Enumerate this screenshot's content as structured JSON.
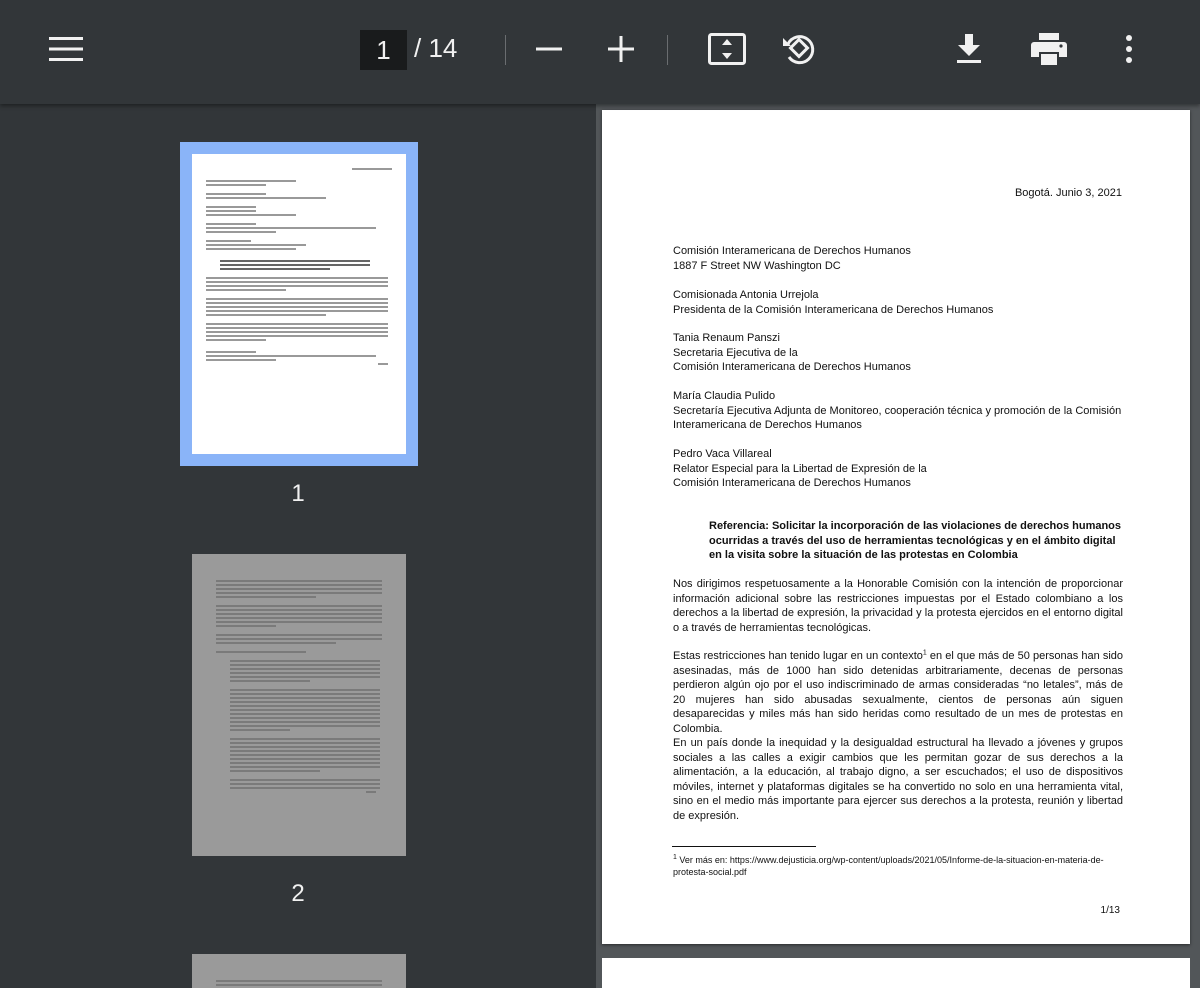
{
  "toolbar": {
    "page_current": "1",
    "page_total": "/ 14",
    "icons": [
      "menu-icon",
      "zoom-out-icon",
      "zoom-in-icon",
      "fit-page-icon",
      "rotate-icon",
      "download-icon",
      "print-icon",
      "more-icon"
    ]
  },
  "sidebar": {
    "thumbnails": [
      {
        "number": "1"
      },
      {
        "number": "2"
      }
    ]
  },
  "document": {
    "date": "Bogotá. Junio 3, 2021",
    "addressee_lines": [
      "Comisión Interamericana de Derechos Humanos",
      "1887 F Street NW Washington DC"
    ],
    "block2": [
      "Comisionada Antonia Urrejola",
      "Presidenta de la Comisión Interamericana de Derechos Humanos"
    ],
    "block3": [
      "Tania Renaum Panszi",
      "Secretaria Ejecutiva de la",
      "Comisión Interamericana de Derechos Humanos"
    ],
    "block4": [
      "María Claudia Pulido",
      "Secretaría Ejecutiva Adjunta de Monitoreo, cooperación técnica y promoción de la Comisión",
      "Interamericana de Derechos Humanos"
    ],
    "block5": [
      "Pedro Vaca Villareal",
      "Relator Especial para la Libertad de Expresión de la",
      "Comisión Interamericana de Derechos Humanos"
    ],
    "reference": "Referencia:  Solicitar la incorporación de las violaciones de derechos humanos ocurridas a través del uso de herramientas tecnológicas y en el ámbito digital en la visita sobre la situación de las protestas en Colombia",
    "para1": "Nos dirigimos respetuosamente a la Honorable Comisión con la intención de proporcionar información adicional sobre las restricciones impuestas por el Estado colombiano a los derechos a la libertad de expresión, la privacidad y la protesta ejercidos en el entorno digital o a través de herramientas tecnológicas.",
    "para2_a": "Estas restricciones han tenido lugar en un contexto",
    "para2_sup": "1",
    "para2_b": " en el que más de 50 personas han sido asesinadas, más de 1000 han sido detenidas arbitrariamente, decenas de personas perdieron algún ojo por el uso indiscriminado de armas consideradas “no letales”, más de 20 mujeres han sido abusadas sexualmente, cientos de personas aún siguen desaparecidas y miles más han sido heridas como resultado de un mes de protestas en Colombia.",
    "para3": "En un país donde la inequidad y la desigualdad estructural ha llevado a jóvenes y grupos sociales a las calles a exigir cambios que les permitan gozar de sus derechos a la alimentación, a la educación, al trabajo digno, a ser escuchados; el uso de dispositivos móviles, internet y plataformas digitales se ha convertido no solo en una herramienta vital, sino en el medio más importante para ejercer sus derechos a la protesta, reunión y libertad de expresión.",
    "footnote_mark": "1",
    "footnote": " Ver más en: https://www.dejusticia.org/wp-content/uploads/2021/05/Informe-de-la-situacion-en-materia-de-protesta-social.pdf",
    "page_number": "1/13"
  },
  "colors": {
    "toolbar_bg": "#323639",
    "viewer_bg": "#525659",
    "selection": "#8ab4f8"
  }
}
